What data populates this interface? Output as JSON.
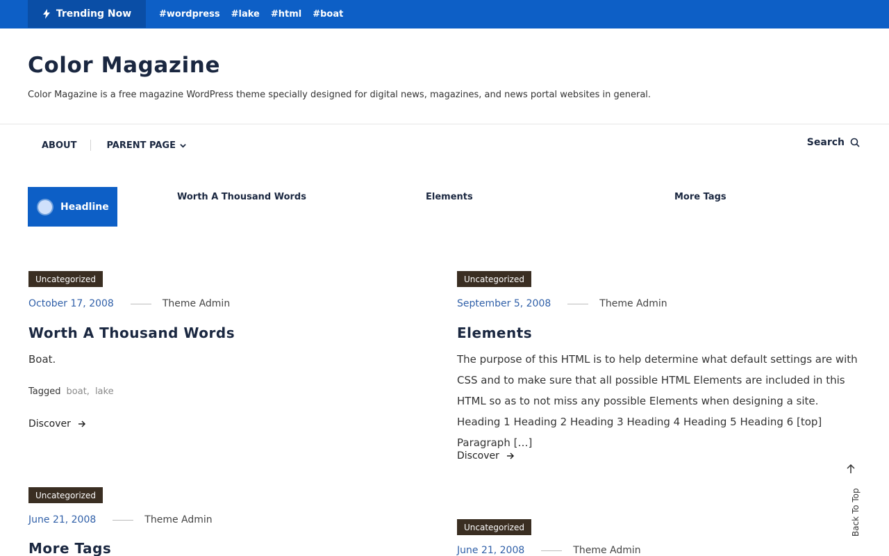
{
  "topbar": {
    "trending_label": "Trending Now",
    "tags": [
      "wordpress",
      "lake",
      "html",
      "boat"
    ]
  },
  "site": {
    "title": "Color Magazine",
    "description": "Color Magazine is a free magazine WordPress theme specially designed for digital news, magazines, and news portal websites in general."
  },
  "nav": {
    "items": [
      "ABOUT",
      "PARENT PAGE"
    ],
    "search_label": "Search"
  },
  "ticker": {
    "label": "Headline",
    "items": [
      "Worth A Thousand Words",
      "Elements",
      "More Tags"
    ]
  },
  "posts": [
    {
      "category": "Uncategorized",
      "date": "October 17, 2008",
      "author": "Theme Admin",
      "title": "Worth A Thousand Words",
      "excerpt": "Boat.",
      "tagged_label": "Tagged",
      "tags": [
        "boat",
        "lake"
      ],
      "discover": "Discover"
    },
    {
      "category": "Uncategorized",
      "date": "September 5, 2008",
      "author": "Theme Admin",
      "title": "Elements",
      "excerpt": "The purpose of this HTML is to help determine what default settings are with CSS and to make sure that all possible HTML Elements are included in this HTML so as to not miss any possible Elements when designing a site. Heading 1 Heading 2 Heading 3 Heading 4 Heading 5 Heading 6 [top] Paragraph […]",
      "discover": "Discover"
    },
    {
      "category": "Uncategorized",
      "date": "June 21, 2008",
      "author": "Theme Admin",
      "title": "More Tags"
    },
    {
      "category": "Uncategorized",
      "date": "June 21, 2008",
      "author": "Theme Admin"
    }
  ],
  "back_to_top": "Back To Top",
  "colors": {
    "primary": "#0d5fc6",
    "category_bg": "#3a2e22",
    "title": "#1a2740",
    "date": "#2f5fa8"
  }
}
